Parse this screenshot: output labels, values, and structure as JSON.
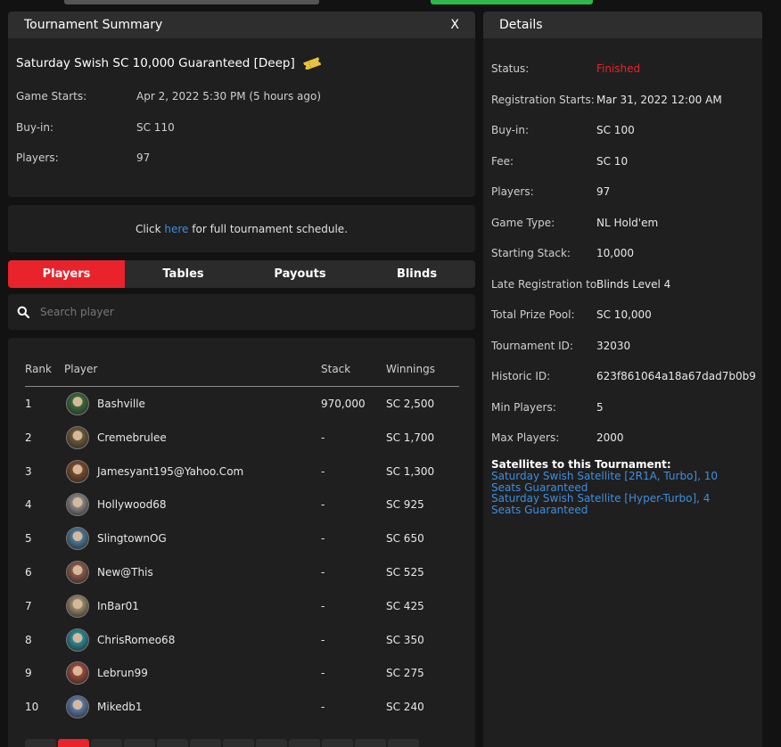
{
  "summary": {
    "header": "Tournament Summary",
    "close_label": "X",
    "title": "Saturday Swish SC 10,000 Guaranteed [Deep]",
    "game_starts_label": "Game Starts:",
    "game_starts_value": "Apr 2, 2022 5:30 PM (5 hours ago)",
    "buyin_label": "Buy-in:",
    "buyin_value": "SC 110",
    "players_label": "Players:",
    "players_value": "97"
  },
  "schedule": {
    "prefix": "Click ",
    "link": "here",
    "suffix": " for full tournament schedule."
  },
  "tabs": [
    {
      "label": "Players",
      "active": true
    },
    {
      "label": "Tables",
      "active": false
    },
    {
      "label": "Payouts",
      "active": false
    },
    {
      "label": "Blinds",
      "active": false
    }
  ],
  "search": {
    "placeholder": "Search player"
  },
  "table": {
    "columns": {
      "rank": "Rank",
      "player": "Player",
      "stack": "Stack",
      "winnings": "Winnings"
    },
    "rows": [
      {
        "rank": "1",
        "player": "Bashville",
        "stack": "970,000",
        "winnings": "SC 2,500"
      },
      {
        "rank": "2",
        "player": "Cremebrulee",
        "stack": "-",
        "winnings": "SC 1,700"
      },
      {
        "rank": "3",
        "player": "Jamesyant195@Yahoo.Com",
        "stack": "-",
        "winnings": "SC 1,300"
      },
      {
        "rank": "4",
        "player": "Hollywood68",
        "stack": "-",
        "winnings": "SC 925"
      },
      {
        "rank": "5",
        "player": "SlingtownOG",
        "stack": "-",
        "winnings": "SC 650"
      },
      {
        "rank": "6",
        "player": "New@This",
        "stack": "-",
        "winnings": "SC 525"
      },
      {
        "rank": "7",
        "player": "InBar01",
        "stack": "-",
        "winnings": "SC 425"
      },
      {
        "rank": "8",
        "player": "ChrisRomeo68",
        "stack": "-",
        "winnings": "SC 350"
      },
      {
        "rank": "9",
        "player": "Lebrun99",
        "stack": "-",
        "winnings": "SC 275"
      },
      {
        "rank": "10",
        "player": "Mikedb1",
        "stack": "-",
        "winnings": "SC 240"
      }
    ]
  },
  "details": {
    "header": "Details",
    "rows": [
      {
        "label": "Status:",
        "value": "Finished"
      },
      {
        "label": "Registration Starts:",
        "value": "Mar 31, 2022 12:00 AM"
      },
      {
        "label": "Buy-in:",
        "value": "SC 100"
      },
      {
        "label": "Fee:",
        "value": "SC 10"
      },
      {
        "label": "Players:",
        "value": "97"
      },
      {
        "label": "Game Type:",
        "value": "NL Hold'em"
      },
      {
        "label": "Starting Stack:",
        "value": "10,000"
      },
      {
        "label": "Late Registration to:",
        "value": "Blinds Level 4"
      },
      {
        "label": "Total Prize Pool:",
        "value": "SC 10,000"
      },
      {
        "label": "Tournament ID:",
        "value": "32030"
      },
      {
        "label": "Historic ID:",
        "value": "623f861064a18a67dad7b0b9"
      },
      {
        "label": "Min Players:",
        "value": "5"
      },
      {
        "label": "Max Players:",
        "value": "2000"
      }
    ],
    "satellites_title": "Satellites to this Tournament:",
    "satellites": [
      "Saturday Swish Satellite [2R1A, Turbo], 10 Seats Guaranteed",
      "Saturday Swish Satellite [Hyper-Turbo], 4 Seats Guaranteed"
    ]
  },
  "colors": {
    "accent_red": "#e8232b",
    "link_blue": "#3d8fe0",
    "panel_bg": "#1f1f1f",
    "page_bg": "#121212"
  }
}
